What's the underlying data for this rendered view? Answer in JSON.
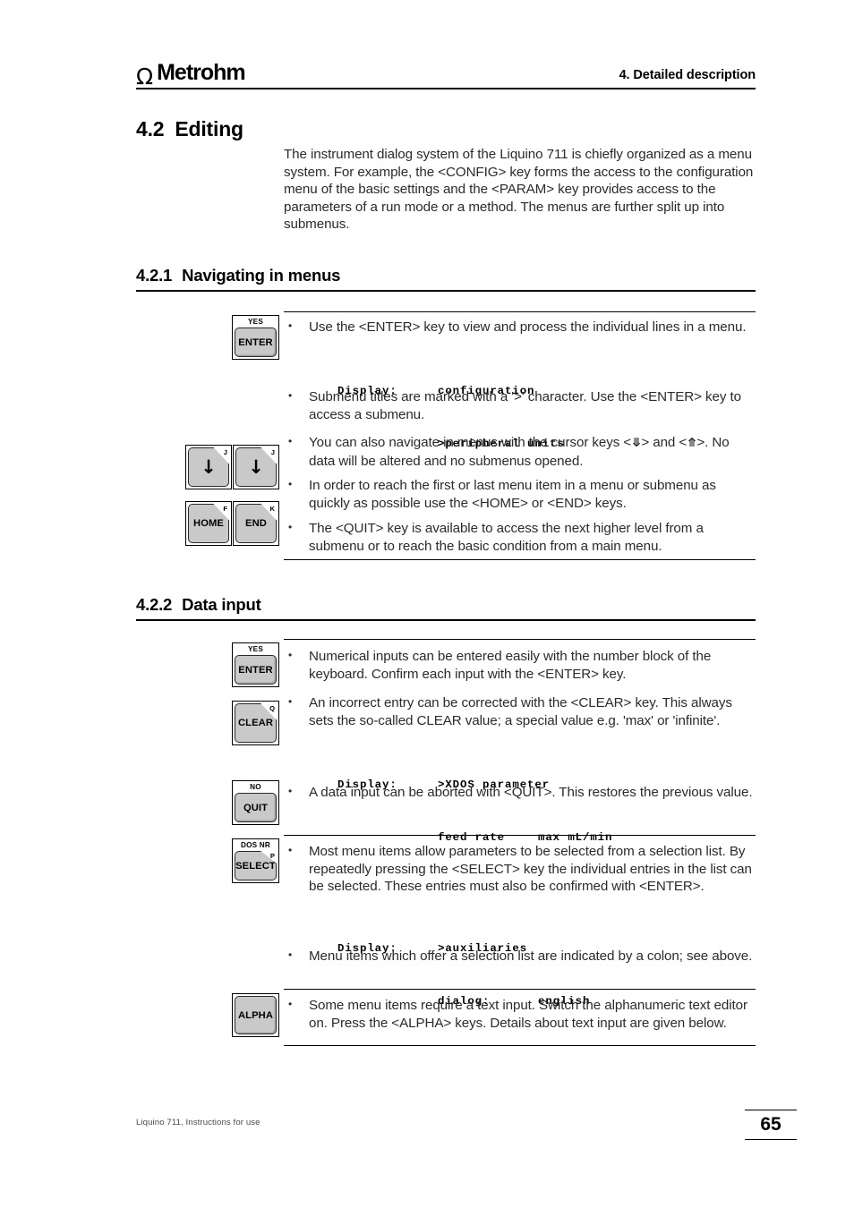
{
  "header": {
    "logo_symbol": "Ω",
    "logo_text": "Metrohm",
    "chapter": "4. Detailed description"
  },
  "section": {
    "number": "4.2",
    "title": "Editing",
    "intro": "The instrument dialog system of the Liquino 711 is chiefly organized as a menu system. For example, the <CONFIG> key forms the access to the configuration menu of the basic settings and the <PARAM> key provides access to the parameters of a run mode or a method. The menus are further split up into submenus."
  },
  "subsection_navigating": {
    "number": "4.2.1",
    "title": "Navigating in menus",
    "bullets": [
      "Use the <ENTER> key to view and process the individual lines in a menu.",
      "Submenu titles are marked with a '>' character. Use the <ENTER> key to access a submenu.",
      "You can also navigate in menus with the cursor keys <↓> and <↑>. No data will be altered and no submenus opened.",
      "In order to reach the first or last menu item in a menu or submenu as quickly as possible use the <HOME> or <END> keys.",
      "The <QUIT> key is available to access the next higher level from a submenu or to reach the basic condition from a main menu."
    ],
    "display_1": {
      "label": "Display:",
      "line1": "configuration",
      "line2": ">peripheral units"
    },
    "keys": [
      {
        "top_label": "YES",
        "label": "ENTER",
        "corner_letter": ""
      },
      {
        "top_label": "",
        "glyph": "↓",
        "corner_letter": "J"
      },
      {
        "top_label": "",
        "glyph": "↓",
        "corner_letter": "J"
      },
      {
        "top_label": "",
        "label": "HOME",
        "corner_letter": "F"
      },
      {
        "top_label": "",
        "label": "END",
        "corner_letter": "K"
      }
    ]
  },
  "subsection_data_input": {
    "number": "4.2.2",
    "title": "Data input",
    "bullets": [
      "Numerical inputs  can be entered easily with the number block of the keyboard. Confirm each input with the <ENTER> key.",
      "An incorrect entry can be corrected with the <CLEAR> key. This always sets the so-called CLEAR value; a special value e.g. 'max' or 'infinite'.",
      "A data input can be aborted with <QUIT>. This restores the previous value.",
      "Most menu items allow parameters to be selected from a selection list. By repeatedly pressing the <SELECT> key the individual entries in the list can be selected. These entries must also be confirmed with <ENTER>.",
      "Menu items which offer a selection list are indicated by a colon; see above.",
      "Some menu items require a text input. Switch the alphanumeric text editor on. Press the <ALPHA> keys. Details about text input are given below."
    ],
    "display_2": {
      "label": "Display:",
      "line1": ">XDOS parameter",
      "line2_left": "feed rate",
      "line2_right": "max mL/min"
    },
    "display_3": {
      "label": "Display:",
      "line1": ">auxiliaries",
      "line2_left": "dialog:",
      "line2_right": "english"
    },
    "keys": [
      {
        "top_label": "YES",
        "label": "ENTER",
        "corner_letter": ""
      },
      {
        "top_label": "",
        "label": "CLEAR",
        "corner_letter": "Q"
      },
      {
        "top_label": "NO",
        "label": "QUIT",
        "corner_letter": ""
      },
      {
        "top_label": "DOS NR",
        "label": "SELECT",
        "corner_letter": "P"
      },
      {
        "top_label": "",
        "label": "ALPHA",
        "corner_letter": ""
      }
    ]
  },
  "footer": {
    "text": "Liquino 711, Instructions for use",
    "page_number": "65"
  }
}
